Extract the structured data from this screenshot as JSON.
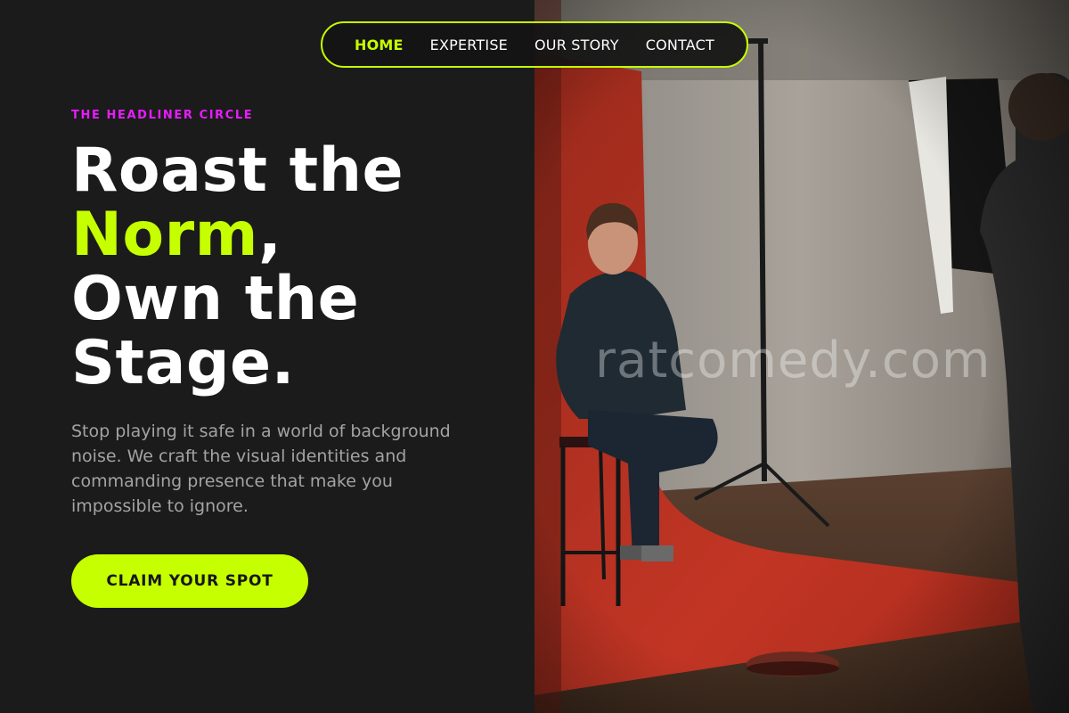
{
  "nav": {
    "items": [
      {
        "label": "HOME",
        "active": true
      },
      {
        "label": "EXPERTISE",
        "active": false
      },
      {
        "label": "OUR STORY",
        "active": false
      },
      {
        "label": "CONTACT",
        "active": false
      }
    ]
  },
  "hero": {
    "eyebrow": "THE HEADLINER CIRCLE",
    "headline": {
      "line1": "Roast the",
      "accent_word": "Norm",
      "accent_suffix": ",",
      "line3": "Own the",
      "line4": "Stage."
    },
    "description": "Stop playing it safe in a world of background noise. We craft the visual identities and commanding presence that make you impossible to ignore.",
    "cta_label": "CLAIM YOUR SPOT"
  },
  "image": {
    "watermark": "ratcomedy.com"
  },
  "colors": {
    "accent": "#c6ff00",
    "eyebrow": "#e81cff",
    "background": "#1b1b1b",
    "text": "#ffffff",
    "muted_text": "#a3a3a3"
  }
}
